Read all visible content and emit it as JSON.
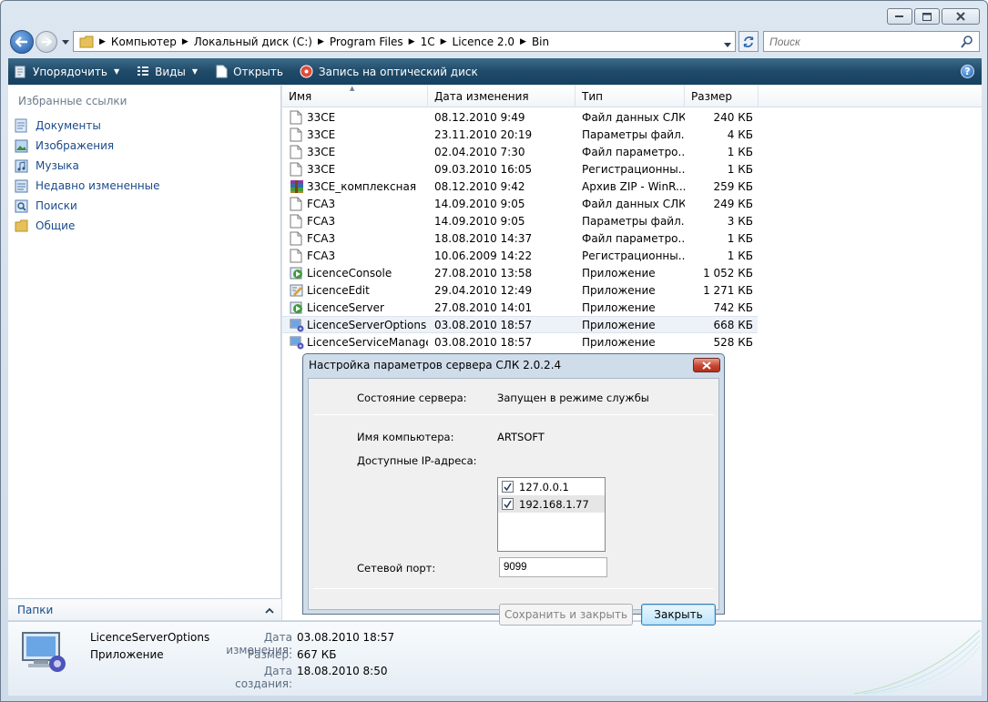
{
  "window": {
    "caption_buttons": [
      "minimize-icon",
      "maximize-icon",
      "close-icon"
    ]
  },
  "address": {
    "crumbs": [
      "Компьютер",
      "Локальный диск (C:)",
      "Program Files",
      "1C",
      "Licence 2.0",
      "Bin"
    ]
  },
  "search": {
    "placeholder": "Поиск"
  },
  "toolbar": {
    "organize": "Упорядочить",
    "views": "Виды",
    "open": "Открыть",
    "burn": "Запись на оптический диск"
  },
  "nav": {
    "title": "Избранные ссылки",
    "items": [
      {
        "label": "Документы",
        "icon": "documents-icon"
      },
      {
        "label": "Изображения",
        "icon": "pictures-icon"
      },
      {
        "label": "Музыка",
        "icon": "music-icon"
      },
      {
        "label": "Недавно измененные",
        "icon": "recent-icon"
      },
      {
        "label": "Поиски",
        "icon": "searches-icon"
      },
      {
        "label": "Общие",
        "icon": "public-icon"
      }
    ],
    "folders_label": "Папки"
  },
  "columns": {
    "name": "Имя",
    "date": "Дата изменения",
    "type": "Тип",
    "size": "Размер"
  },
  "files": [
    {
      "name": "33CE",
      "date": "08.12.2010 9:49",
      "type": "Файл данных СЛК",
      "size": "240 КБ",
      "icon": "file-icon"
    },
    {
      "name": "33CE",
      "date": "23.11.2010 20:19",
      "type": "Параметры файл...",
      "size": "4 КБ",
      "icon": "file-icon"
    },
    {
      "name": "33CE",
      "date": "02.04.2010 7:30",
      "type": "Файл параметро...",
      "size": "1 КБ",
      "icon": "file-icon"
    },
    {
      "name": "33CE",
      "date": "09.03.2010 16:05",
      "type": "Регистрационны...",
      "size": "1 КБ",
      "icon": "file-icon"
    },
    {
      "name": "33CE_комплексная",
      "date": "08.12.2010 9:42",
      "type": "Архив ZIP - WinR...",
      "size": "259 КБ",
      "icon": "archive-icon"
    },
    {
      "name": "FCA3",
      "date": "14.09.2010 9:05",
      "type": "Файл данных СЛК",
      "size": "249 КБ",
      "icon": "file-icon"
    },
    {
      "name": "FCA3",
      "date": "14.09.2010 9:05",
      "type": "Параметры файл...",
      "size": "3 КБ",
      "icon": "file-icon"
    },
    {
      "name": "FCA3",
      "date": "18.08.2010 14:37",
      "type": "Файл параметро...",
      "size": "1 КБ",
      "icon": "file-icon"
    },
    {
      "name": "FCA3",
      "date": "10.06.2009 14:22",
      "type": "Регистрационны...",
      "size": "1 КБ",
      "icon": "file-icon"
    },
    {
      "name": "LicenceConsole",
      "date": "27.08.2010 13:58",
      "type": "Приложение",
      "size": "1 052 КБ",
      "icon": "app-icon"
    },
    {
      "name": "LicenceEdit",
      "date": "29.04.2010 12:49",
      "type": "Приложение",
      "size": "1 271 КБ",
      "icon": "edit-app-icon"
    },
    {
      "name": "LicenceServer",
      "date": "27.08.2010 14:01",
      "type": "Приложение",
      "size": "742 КБ",
      "icon": "app-icon"
    },
    {
      "name": "LicenceServerOptions",
      "date": "03.08.2010 18:57",
      "type": "Приложение",
      "size": "668 КБ",
      "icon": "gear-app-icon",
      "selected": true
    },
    {
      "name": "LicenceServiceManager",
      "date": "03.08.2010 18:57",
      "type": "Приложение",
      "size": "528 КБ",
      "icon": "gear-app-icon"
    }
  ],
  "dialog": {
    "title": "Настройка параметров сервера СЛК 2.0.2.4",
    "status_label": "Состояние сервера:",
    "status_value": "Запущен в режиме службы",
    "computer_label": "Имя компьютера:",
    "computer_value": "ARTSOFT",
    "ip_label": "Доступные IP-адреса:",
    "ips": [
      {
        "address": "127.0.0.1",
        "checked": true
      },
      {
        "address": "192.168.1.77",
        "checked": true
      }
    ],
    "port_label": "Сетевой порт:",
    "port_value": "9099",
    "save_close": "Сохранить и закрыть",
    "close": "Закрыть"
  },
  "details": {
    "name": "LicenceServerOptions",
    "kind": "Приложение",
    "modified_label": "Дата изменения:",
    "modified_value": "03.08.2010 18:57",
    "size_label": "Размер:",
    "size_value": "667 КБ",
    "created_label": "Дата создания:",
    "created_value": "18.08.2010 8:50"
  }
}
